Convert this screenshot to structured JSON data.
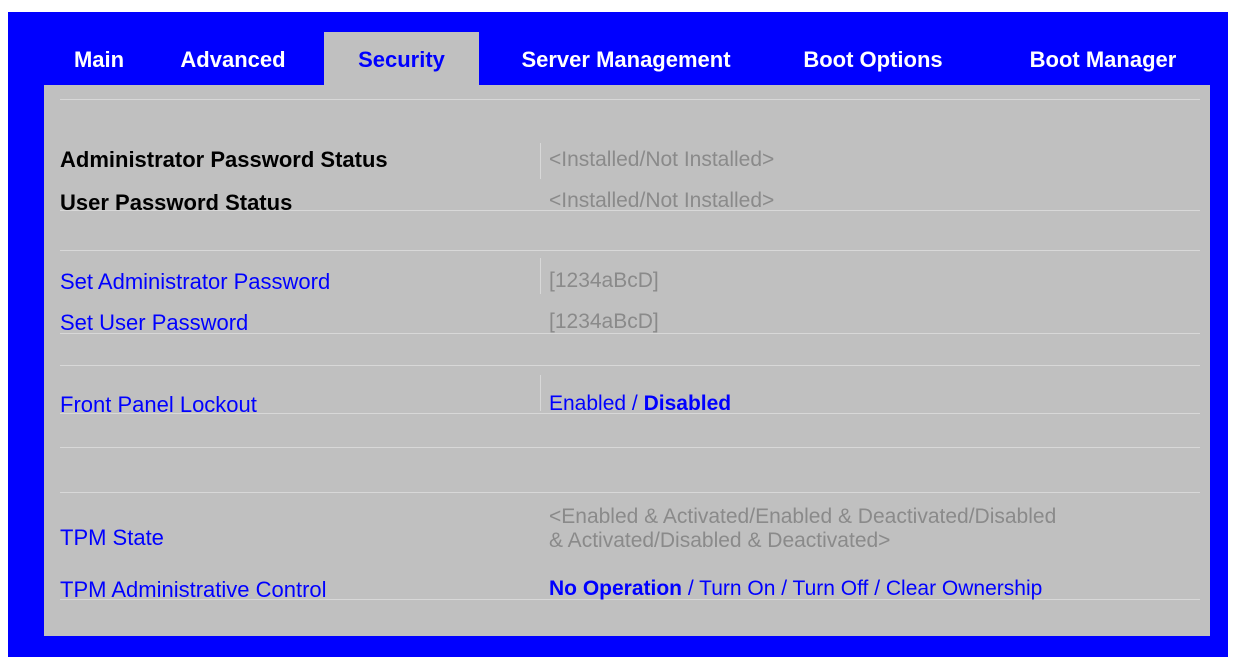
{
  "tabs": [
    {
      "label": "Main"
    },
    {
      "label": "Advanced"
    },
    {
      "label": "Security",
      "active": true
    },
    {
      "label": "Server Management"
    },
    {
      "label": "Boot Options"
    },
    {
      "label": "Boot Manager"
    }
  ],
  "security": {
    "admin_password_status": {
      "label": "Administrator Password Status",
      "value": "<Installed/Not Installed>"
    },
    "user_password_status": {
      "label": "User Password Status",
      "value": "<Installed/Not Installed>"
    },
    "set_admin_password": {
      "label": "Set Administrator Password",
      "value": "[1234aBcD]"
    },
    "set_user_password": {
      "label": "Set User Password",
      "value": "[1234aBcD]"
    },
    "front_panel_lockout": {
      "label": "Front Panel Lockout",
      "options": [
        "Enabled",
        "Disabled"
      ],
      "separator": " / ",
      "selected": "Disabled"
    },
    "tpm_state": {
      "label": "TPM State",
      "value_line1": "<Enabled & Activated/Enabled & Deactivated/Disabled",
      "value_line2": "& Activated/Disabled & Deactivated>"
    },
    "tpm_admin_control": {
      "label": "TPM Administrative Control",
      "options": [
        "No Operation",
        "Turn On",
        "Turn Off",
        "Clear Ownership"
      ],
      "separator": " / ",
      "selected": "No Operation"
    }
  },
  "colors": {
    "frame": "#0000ff",
    "panel": "#c0c0c0",
    "label_link": "#0000ff",
    "value_gray": "#8a8a8a"
  }
}
